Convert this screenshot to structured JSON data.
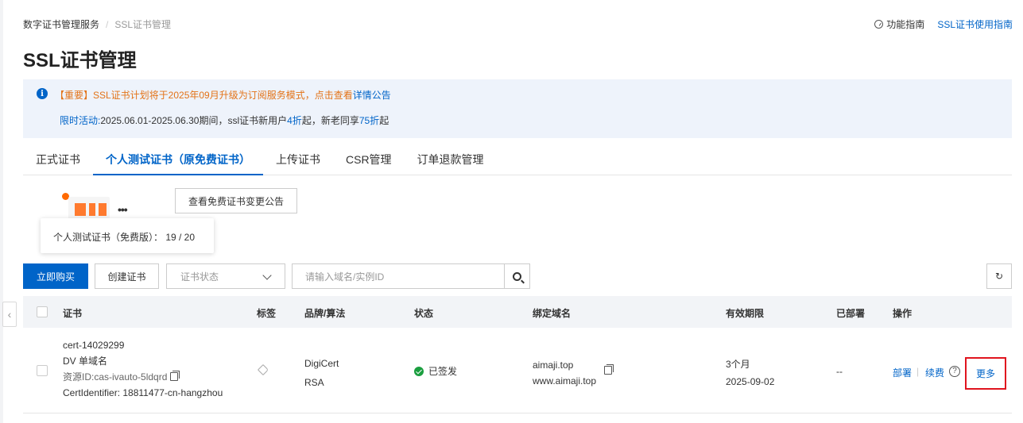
{
  "breadcrumb": {
    "root": "数字证书管理服务",
    "sep": "/",
    "current": "SSL证书管理"
  },
  "top_links": {
    "guide": "功能指南",
    "usage_guide": "SSL证书使用指南"
  },
  "page_title": "SSL证书管理",
  "notice": {
    "line1_prefix": "【重要】SSL证书计划将于2025年09月升级为订阅服务模式，点击查看",
    "line1_link": "详情公告",
    "line2_a": "限时活动:",
    "line2_b": "2025.06.01-2025.06.30期间，ssl证书新用户",
    "line2_hl1": "4折",
    "line2_c": "起，新老同享",
    "line2_hl2": "75折",
    "line2_d": "起"
  },
  "tabs": [
    {
      "label": "正式证书"
    },
    {
      "label": "个人测试证书（原免费证书）"
    },
    {
      "label": "上传证书"
    },
    {
      "label": "CSR管理"
    },
    {
      "label": "订单退款管理"
    }
  ],
  "illustration": {
    "dots": "•••"
  },
  "buttons": {
    "view_notice": "查看免费证书变更公告",
    "buy_now": "立即购买",
    "create_cert": "创建证书"
  },
  "tooltip": {
    "text": "个人测试证书（免费版）：  19 / 20"
  },
  "filters": {
    "status_placeholder": "证书状态",
    "search_placeholder": "请输入域名/实例ID"
  },
  "table": {
    "headers": {
      "cert": "证书",
      "tag": "标签",
      "brand": "品牌/算法",
      "status": "状态",
      "domain": "绑定域名",
      "validity": "有效期限",
      "deployed": "已部署",
      "actions": "操作"
    },
    "rows": [
      {
        "cert_name": "cert-14029299",
        "cert_type": "DV 单域名",
        "resource_id": "资源ID:cas-ivauto-5ldqrd",
        "cert_identifier": "CertIdentifier: 18811477-cn-hangzhou",
        "brand": "DigiCert",
        "algorithm": "RSA",
        "status": "已签发",
        "domain1": "aimaji.top",
        "domain2": "www.aimaji.top",
        "validity_period": "3个月",
        "validity_date": "2025-09-02",
        "deployed": "--",
        "action_deploy": "部署",
        "action_renew": "续费",
        "action_more": "更多"
      }
    ]
  },
  "colors": {
    "accent": "#0064c8",
    "warning": "#e37318",
    "success": "#1a9e3f",
    "highlight_box": "#e0141e"
  }
}
